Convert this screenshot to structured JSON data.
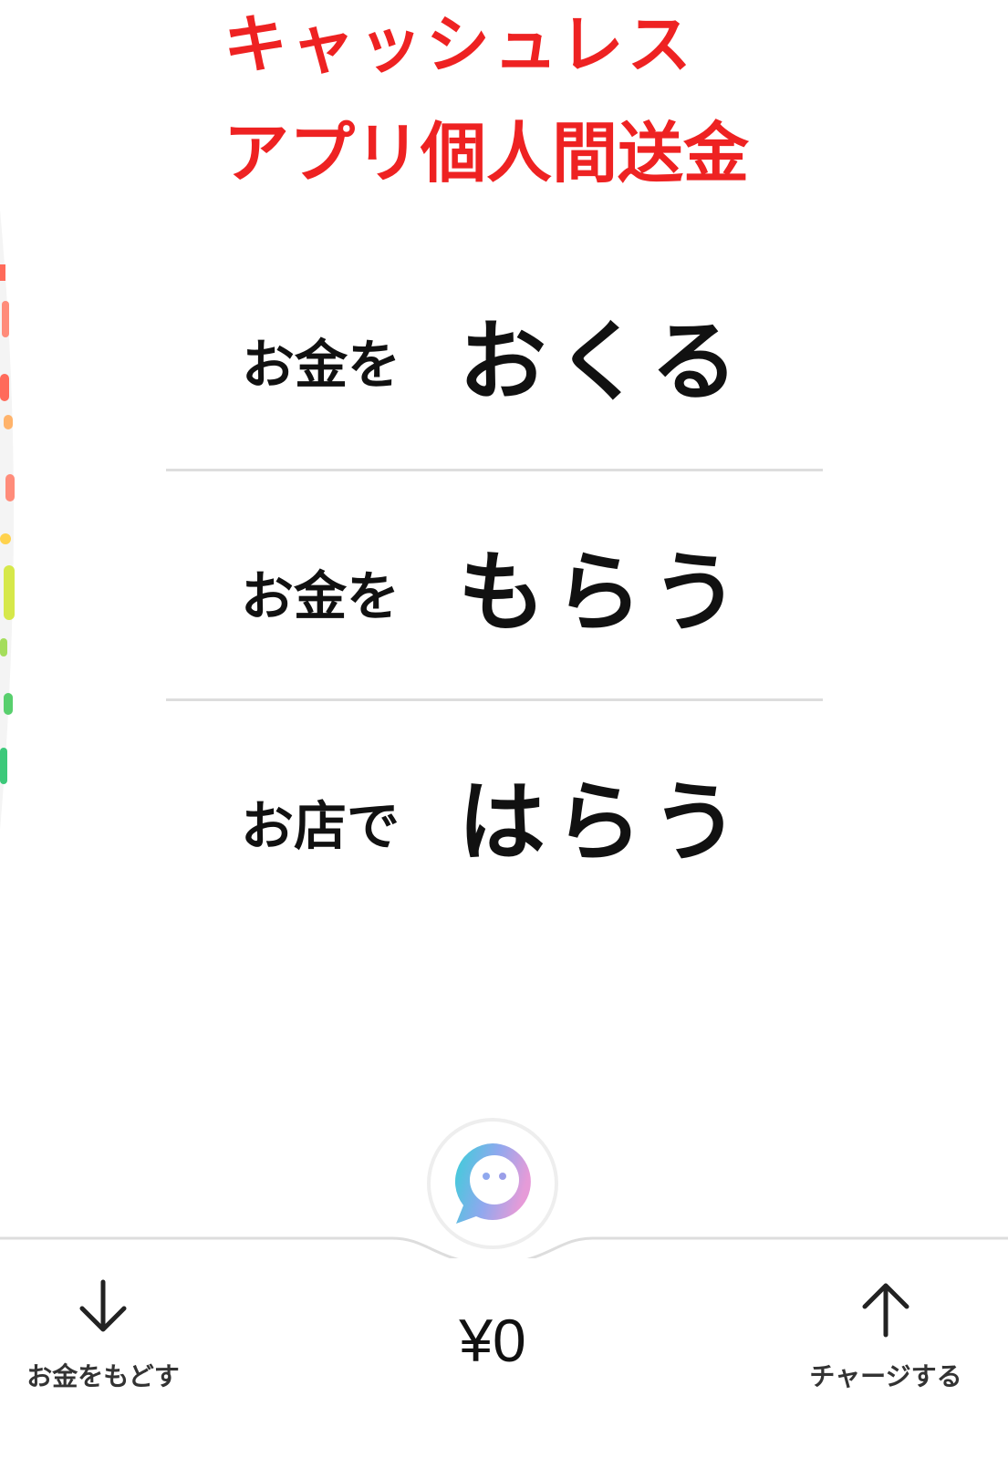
{
  "headline": {
    "line1": "キャッシュレス",
    "line2": "アプリ個人間送金",
    "color": "#ee2222"
  },
  "menu": {
    "items": [
      {
        "prefix": "お金を",
        "verb": "おくる"
      },
      {
        "prefix": "お金を",
        "verb": "もらう"
      },
      {
        "prefix": "お店で",
        "verb": "はらう"
      }
    ]
  },
  "bottom_bar": {
    "withdraw_label": "お金をもどす",
    "withdraw_icon": "arrow-down-icon",
    "balance": "¥0",
    "charge_label": "チャージする",
    "charge_icon": "arrow-up-icon",
    "center_icon": "chat-bubble-face-icon"
  }
}
